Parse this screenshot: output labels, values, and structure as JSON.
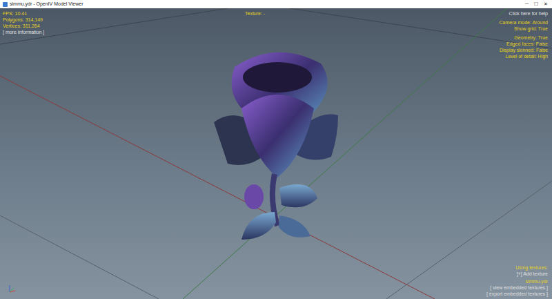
{
  "window": {
    "title": "simmu.ydr - OpenIV Model Viewer",
    "controls": [
      "─",
      "☐",
      "✕"
    ]
  },
  "stats": [
    "FPS: 10.41",
    "Polygons: 314,149",
    "Vertices: 311,264",
    "[ more information ]"
  ],
  "top_center": "Texture: -",
  "settings": {
    "help": "Click here for help",
    "groups": [
      [
        "Camera mode: Around",
        "Show grid: True"
      ],
      [
        "Geometry: True",
        "Edged faces: False",
        "Display skinned: False",
        "Level of detail: High"
      ]
    ]
  },
  "textures": {
    "heading": "Using textures:",
    "add": "[+] Add texture",
    "file": "simmu.ydr",
    "actions": [
      "[ view embedded textures ]",
      "[ export embedded textures ]"
    ]
  }
}
